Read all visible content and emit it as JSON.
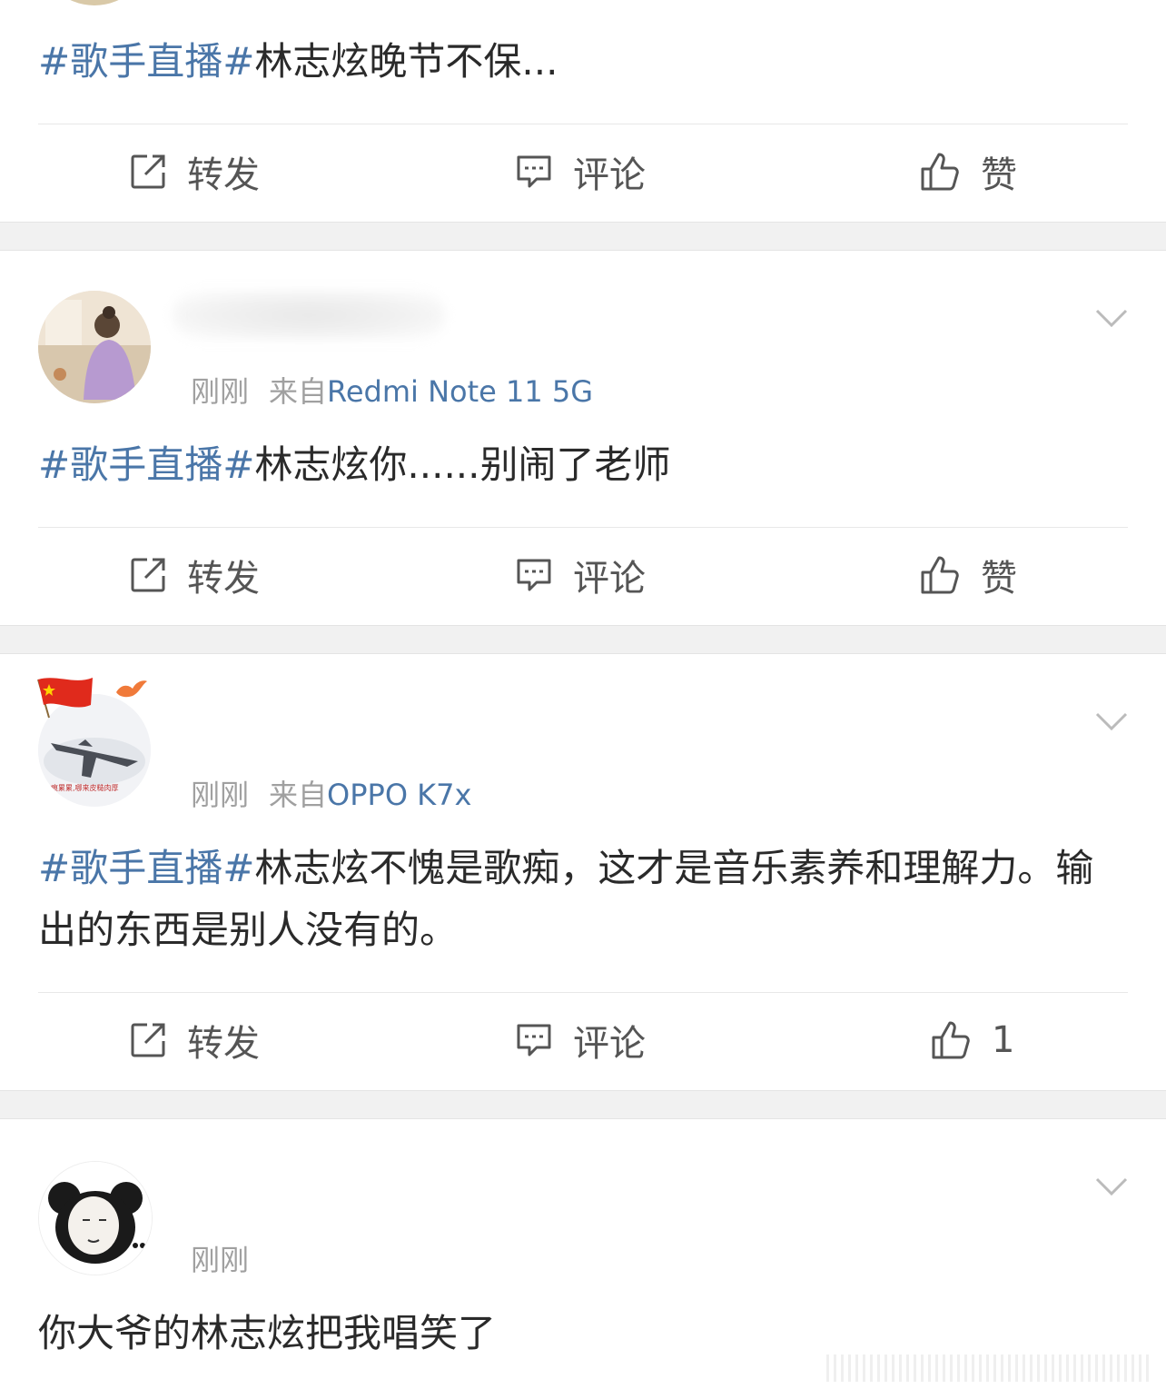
{
  "posts": [
    {
      "text_topic": "#歌手直播#",
      "text_body": "林志炫晚节不保...",
      "actions": {
        "repost": "转发",
        "comment": "评论",
        "like": "赞"
      }
    },
    {
      "time": "刚刚",
      "source_prefix": "来自",
      "device": "Redmi Note 11 5G",
      "text_topic": "#歌手直播#",
      "text_body": "林志炫你......别闹了老师",
      "actions": {
        "repost": "转发",
        "comment": "评论",
        "like": "赞"
      }
    },
    {
      "time": "刚刚",
      "source_prefix": "来自",
      "device": "OPPO K7x",
      "avatar_caption": "伤痕累累,哪来皮糙肉厚",
      "text_topic": "#歌手直播#",
      "text_body": "林志炫不愧是歌痴，这才是音乐素养和理解力。输出的东西是别人没有的。",
      "actions": {
        "repost": "转发",
        "comment": "评论",
        "like_count": "1"
      }
    },
    {
      "time": "刚刚",
      "text_body": "你大爷的林志炫把我唱笑了"
    }
  ],
  "colors": {
    "topic": "#4a76a8",
    "meta": "#a0a0a0",
    "separator": "#f1f1f1"
  }
}
